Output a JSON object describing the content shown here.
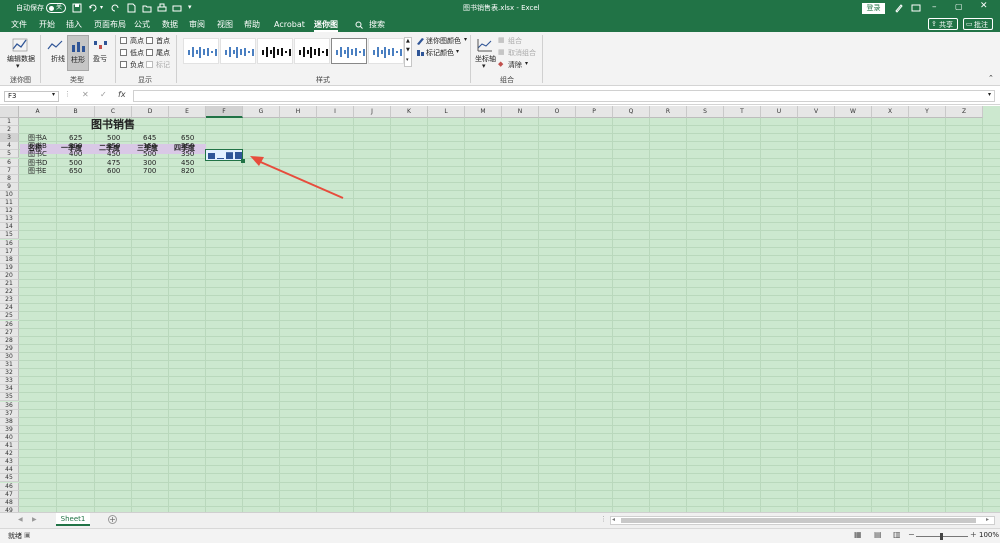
{
  "titlebar": {
    "autosave_label": "自动保存",
    "autosave_state": "关",
    "doc_title": "图书销售表.xlsx  -  Excel",
    "login_label": "登录"
  },
  "menu": {
    "items": [
      "文件",
      "开始",
      "插入",
      "页面布局",
      "公式",
      "数据",
      "审阅",
      "视图",
      "帮助",
      "Acrobat",
      "迷你图"
    ],
    "active": "迷你图",
    "search_label": "搜索",
    "share_label": "共享",
    "comment_label": "批注"
  },
  "ribbon": {
    "edit_data_label": "编辑数据",
    "group_sparkline": "迷你图",
    "type_line": "折线",
    "type_column": "柱形",
    "type_winloss": "盈亏",
    "group_type": "类型",
    "show": {
      "high": "高点",
      "low": "低点",
      "negative": "负点",
      "first": "首点",
      "last": "尾点",
      "markers": "标记"
    },
    "group_show": "显示",
    "group_style": "样式",
    "sparkline_color": "迷你图颜色",
    "marker_color": "标记颜色",
    "axis_label": "坐标轴",
    "group_label": "组合",
    "ungroup_label": "取消组合",
    "clear_label": "清除",
    "group_group": "组合"
  },
  "formula_bar": {
    "name_box": "F3",
    "value": ""
  },
  "columns": [
    "A",
    "B",
    "C",
    "D",
    "E",
    "F",
    "G",
    "H",
    "I",
    "J",
    "K",
    "L",
    "M",
    "N",
    "O",
    "P",
    "Q",
    "R",
    "S",
    "T",
    "U",
    "V",
    "W",
    "X",
    "Y",
    "Z"
  ],
  "sheet": {
    "title": "图书销售",
    "headers": [
      "名称",
      "一季度",
      "二季度",
      "三季度",
      "四季度"
    ],
    "rows": [
      [
        "图书A",
        "625",
        "500",
        "645",
        "650"
      ],
      [
        "图书B",
        "300",
        "350",
        "150",
        "250"
      ],
      [
        "图书C",
        "400",
        "450",
        "500",
        "350"
      ],
      [
        "图书D",
        "500",
        "475",
        "300",
        "450"
      ],
      [
        "图书E",
        "650",
        "600",
        "700",
        "820"
      ]
    ],
    "sparkline_values": [
      625,
      500,
      645,
      650
    ],
    "sparkline_color": "#2f5597"
  },
  "tabs": {
    "sheet1": "Sheet1"
  },
  "status": {
    "ready": "就绪",
    "zoom": "100%"
  },
  "colors": {
    "excel_green": "#217346",
    "grid_bg": "#cce8cf",
    "header_band": "#d9c8e6",
    "arrow": "#e74c3c"
  }
}
